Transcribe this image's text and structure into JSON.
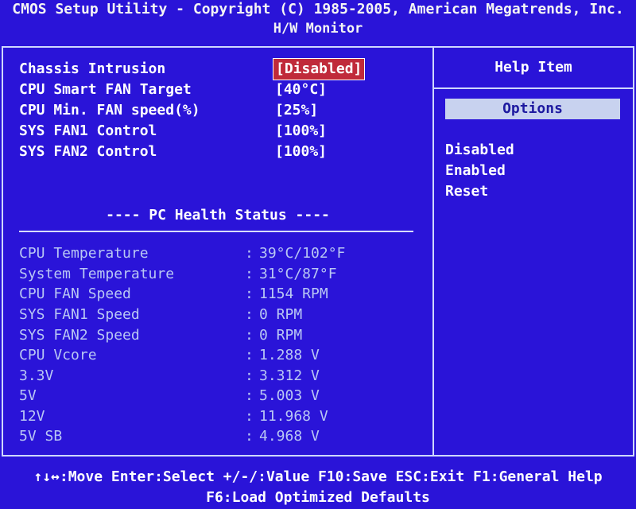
{
  "header": {
    "title": "CMOS Setup Utility - Copyright (C) 1985-2005, American Megatrends, Inc.",
    "subtitle": "H/W Monitor"
  },
  "settings": [
    {
      "label": "Chassis Intrusion",
      "value": "[Disabled]"
    },
    {
      "label": "CPU Smart FAN Target",
      "value": "[40°C]"
    },
    {
      "label": "CPU Min. FAN speed(%)",
      "value": "[25%]"
    },
    {
      "label": "SYS FAN1 Control",
      "value": "[100%]"
    },
    {
      "label": "SYS FAN2 Control",
      "value": "[100%]"
    }
  ],
  "health": {
    "title": "---- PC Health Status ----",
    "rows": [
      {
        "label": "CPU Temperature",
        "value": "39°C/102°F"
      },
      {
        "label": "System Temperature",
        "value": "31°C/87°F"
      },
      {
        "label": "CPU FAN Speed",
        "value": "1154 RPM"
      },
      {
        "label": "SYS FAN1 Speed",
        "value": "0 RPM"
      },
      {
        "label": "SYS FAN2 Speed",
        "value": "0 RPM"
      },
      {
        "label": "CPU Vcore",
        "value": "1.288 V"
      },
      {
        "label": "3.3V",
        "value": "3.312 V"
      },
      {
        "label": "5V",
        "value": "5.003 V"
      },
      {
        "label": "12V",
        "value": "11.968 V"
      },
      {
        "label": "5V SB",
        "value": "4.968 V"
      }
    ]
  },
  "help": {
    "header": "Help Item",
    "options_label": "Options",
    "options": [
      "Disabled",
      "Enabled",
      "Reset"
    ]
  },
  "footer": {
    "line1": "↑↓↔:Move  Enter:Select  +/-/:Value  F10:Save  ESC:Exit  F1:General Help",
    "line2": "F6:Load Optimized Defaults"
  },
  "colors": {
    "background": "#2a14d8",
    "selected_value_bg": "#c02a3a",
    "options_bg": "#c8d2ef",
    "dim_text": "#b9c7f4"
  }
}
